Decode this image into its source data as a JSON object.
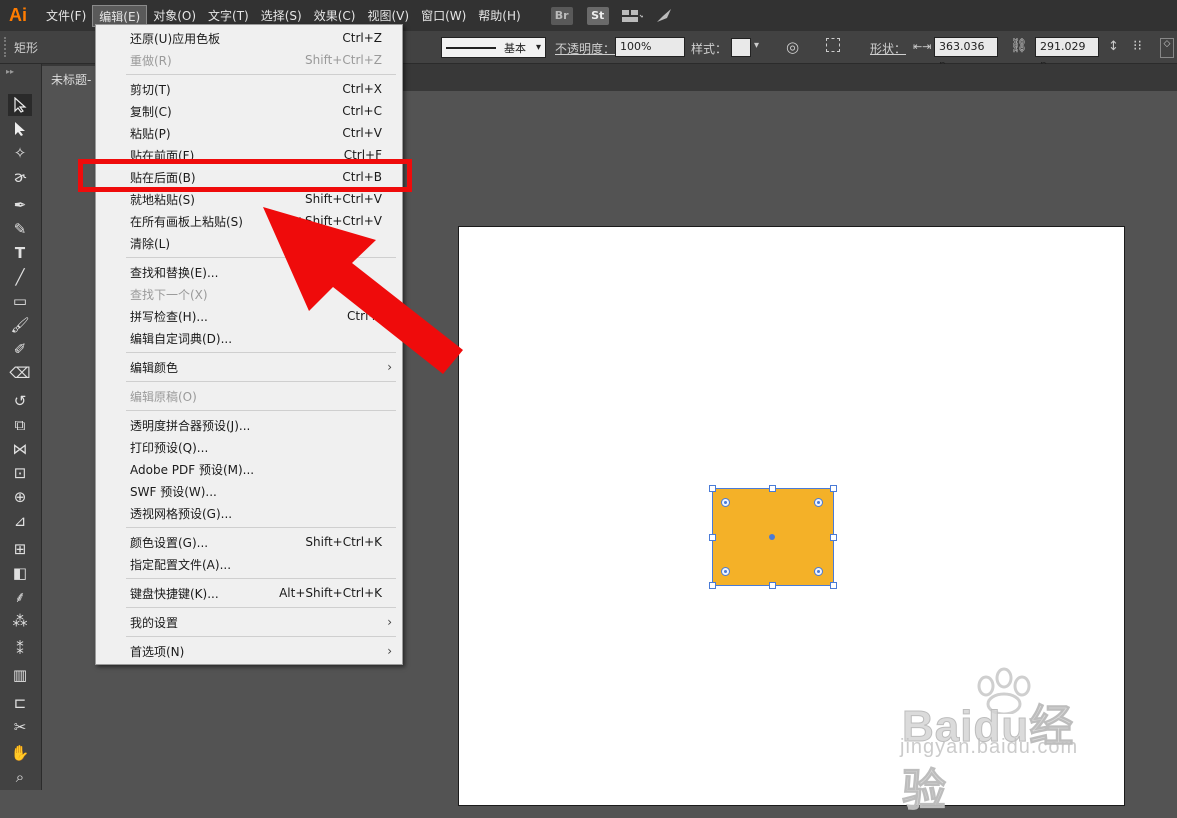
{
  "app": {
    "logo": "Ai"
  },
  "menubar": {
    "items": [
      "文件(F)",
      "编辑(E)",
      "对象(O)",
      "文字(T)",
      "选择(S)",
      "效果(C)",
      "视图(V)",
      "窗口(W)",
      "帮助(H)"
    ],
    "br_label": "Br",
    "st_label": "St"
  },
  "optionsbar": {
    "tool_name": "矩形",
    "stroke_style": "基本",
    "opacity_label": "不透明度：",
    "opacity_value": "100%",
    "style_label": "样式：",
    "shape_label": "形状：",
    "width_value": "363.036 p",
    "height_value": "291.029 p"
  },
  "document": {
    "tab_title": "未标题-"
  },
  "edit_menu": {
    "items": [
      {
        "label": "还原(U)应用色板",
        "shortcut": "Ctrl+Z"
      },
      {
        "label": "重做(R)",
        "shortcut": "Shift+Ctrl+Z"
      },
      {
        "label": "剪切(T)",
        "shortcut": "Ctrl+X"
      },
      {
        "label": "复制(C)",
        "shortcut": "Ctrl+C"
      },
      {
        "label": "粘贴(P)",
        "shortcut": "Ctrl+V"
      },
      {
        "label": "贴在前面(F)",
        "shortcut": "Ctrl+F"
      },
      {
        "label": "贴在后面(B)",
        "shortcut": "Ctrl+B"
      },
      {
        "label": "就地粘贴(S)",
        "shortcut": "Shift+Ctrl+V"
      },
      {
        "label": "在所有画板上粘贴(S)",
        "shortcut": "Alt+Shift+Ctrl+V"
      },
      {
        "label": "清除(L)",
        "shortcut": ""
      },
      {
        "label": "查找和替换(E)...",
        "shortcut": ""
      },
      {
        "label": "查找下一个(X)",
        "shortcut": ""
      },
      {
        "label": "拼写检查(H)...",
        "shortcut": "Ctrl+I"
      },
      {
        "label": "编辑自定词典(D)...",
        "shortcut": ""
      },
      {
        "label": "编辑颜色",
        "shortcut": ""
      },
      {
        "label": "编辑原稿(O)",
        "shortcut": ""
      },
      {
        "label": "透明度拼合器预设(J)...",
        "shortcut": ""
      },
      {
        "label": "打印预设(Q)...",
        "shortcut": ""
      },
      {
        "label": "Adobe PDF 预设(M)...",
        "shortcut": ""
      },
      {
        "label": "SWF 预设(W)...",
        "shortcut": ""
      },
      {
        "label": "透视网格预设(G)...",
        "shortcut": ""
      },
      {
        "label": "颜色设置(G)...",
        "shortcut": "Shift+Ctrl+K"
      },
      {
        "label": "指定配置文件(A)...",
        "shortcut": ""
      },
      {
        "label": "键盘快捷键(K)...",
        "shortcut": "Alt+Shift+Ctrl+K"
      },
      {
        "label": "我的设置",
        "shortcut": ""
      },
      {
        "label": "首选项(N)",
        "shortcut": ""
      }
    ]
  },
  "watermark": {
    "brand": "Baidu经验",
    "url": "jingyan.baidu.com"
  },
  "colors": {
    "shape_fill": "#f4b128",
    "highlight": "#ef0b0b",
    "selection": "#4a7bd6"
  }
}
